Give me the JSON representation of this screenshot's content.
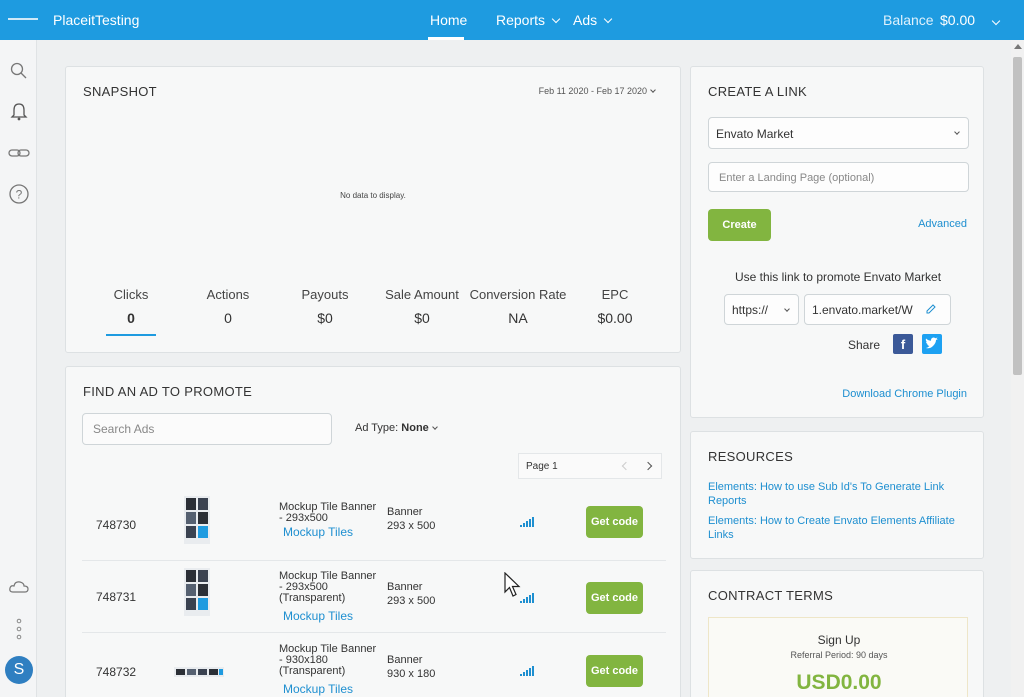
{
  "topbar": {
    "brand": "PlaceitTesting",
    "nav": {
      "home": "Home",
      "reports": "Reports",
      "ads": "Ads"
    },
    "balance_label": "Balance",
    "balance_value": "$0.00"
  },
  "rail": {
    "icons": [
      "search-icon",
      "bell-icon",
      "link-icon",
      "help-icon",
      "cloud-icon",
      "more-icon"
    ],
    "avatar_initial": "S"
  },
  "snapshot": {
    "title": "SNAPSHOT",
    "date_range": "Feb 11 2020 - Feb 17 2020",
    "no_data": "No data to display.",
    "metrics": [
      {
        "label": "Clicks",
        "value": "0"
      },
      {
        "label": "Actions",
        "value": "0"
      },
      {
        "label": "Payouts",
        "value": "$0"
      },
      {
        "label": "Sale Amount",
        "value": "$0"
      },
      {
        "label": "Conversion Rate",
        "value": "NA"
      },
      {
        "label": "EPC",
        "value": "$0.00"
      }
    ]
  },
  "find_ad": {
    "title": "FIND AN AD TO PROMOTE",
    "search_placeholder": "Search Ads",
    "ad_type_label": "Ad Type:",
    "ad_type_value": "None",
    "page_label": "Page 1",
    "get_code_label": "Get code",
    "rows": [
      {
        "id": "748730",
        "name": "Mockup Tile Banner - 293x500",
        "category": "Mockup Tiles",
        "type": "Banner",
        "size": "293 x 500"
      },
      {
        "id": "748731",
        "name": "Mockup Tile Banner - 293x500 (Transparent)",
        "category": "Mockup Tiles",
        "type": "Banner",
        "size": "293 x 500"
      },
      {
        "id": "748732",
        "name": "Mockup Tile Banner - 930x180 (Transparent)",
        "category": "Mockup Tiles",
        "type": "Banner",
        "size": "930 x 180"
      }
    ]
  },
  "create_link": {
    "title": "CREATE A LINK",
    "market_value": "Envato Market",
    "landing_placeholder": "Enter a Landing Page (optional)",
    "create_label": "Create",
    "advanced_label": "Advanced",
    "promote_text": "Use this link to promote Envato Market",
    "protocol_value": "https://",
    "url_value": "1.envato.market/W",
    "share_label": "Share",
    "chrome_plugin_label": "Download Chrome Plugin"
  },
  "resources": {
    "title": "RESOURCES",
    "links": [
      "Elements: How to use Sub Id's To Generate Link Reports",
      "Elements: How to Create Envato Elements Affiliate Links"
    ]
  },
  "contract": {
    "title": "CONTRACT TERMS",
    "signup": "Sign Up",
    "referral_period": "Referral Period: 90 days",
    "amount": "USD0.00"
  },
  "colors": {
    "topbar": "#1e9be0",
    "button_green": "#82b540",
    "link_blue": "#1e8fd0",
    "facebook": "#3b5998",
    "twitter": "#1da1f2"
  }
}
